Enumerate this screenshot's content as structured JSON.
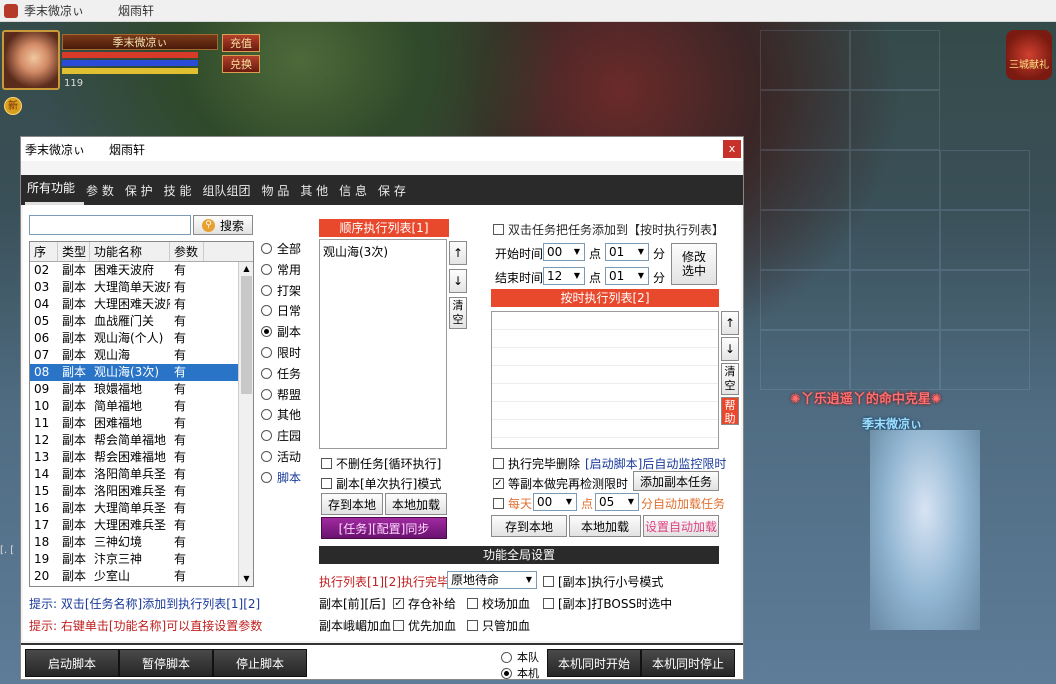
{
  "window": {
    "title_user": "季末微凉ぃ",
    "title_server": "烟雨轩"
  },
  "hud": {
    "player_name": "季末微凉ぃ",
    "level": "119",
    "recharge": "充值",
    "exchange": "兑换",
    "new_badge": "新",
    "gift_label": "三城献礼"
  },
  "scene": {
    "char_title": "✺丫乐逍遥丫的命中克星✺",
    "char_name": "季末微凉ぃ",
    "left_edge": "[. ["
  },
  "dialog": {
    "title_user": "季末微凉ぃ",
    "title_server": "烟雨轩",
    "close": "x",
    "tabs": [
      "所有功能",
      "参 数",
      "保 护",
      "技 能",
      "组队组团",
      "物 品",
      "其 他",
      "信 息",
      "保 存"
    ],
    "search": {
      "value": "",
      "button": "搜索"
    },
    "table": {
      "headers": [
        "序",
        "类型",
        "功能名称",
        "参数"
      ],
      "rows": [
        [
          "02",
          "副本",
          "困难天波府",
          "有"
        ],
        [
          "03",
          "副本",
          "大理简单天波府",
          "有"
        ],
        [
          "04",
          "副本",
          "大理困难天波府",
          "有"
        ],
        [
          "05",
          "副本",
          "血战雁门关",
          "有"
        ],
        [
          "06",
          "副本",
          "观山海(个人)",
          "有"
        ],
        [
          "07",
          "副本",
          "观山海",
          "有"
        ],
        [
          "08",
          "副本",
          "观山海(3次)",
          "有"
        ],
        [
          "09",
          "副本",
          "琅嬛福地",
          "有"
        ],
        [
          "10",
          "副本",
          "简单福地",
          "有"
        ],
        [
          "11",
          "副本",
          "困难福地",
          "有"
        ],
        [
          "12",
          "副本",
          "帮会简单福地",
          "有"
        ],
        [
          "13",
          "副本",
          "帮会困难福地",
          "有"
        ],
        [
          "14",
          "副本",
          "洛阳简单兵圣",
          "有"
        ],
        [
          "15",
          "副本",
          "洛阳困难兵圣",
          "有"
        ],
        [
          "16",
          "副本",
          "大理简单兵圣",
          "有"
        ],
        [
          "17",
          "副本",
          "大理困难兵圣",
          "有"
        ],
        [
          "18",
          "副本",
          "三神幻境",
          "有"
        ],
        [
          "19",
          "副本",
          "汴京三神",
          "有"
        ],
        [
          "20",
          "副本",
          "少室山",
          "有"
        ]
      ],
      "selected_row": 6
    },
    "categories": [
      "全部",
      "常用",
      "打架",
      "日常",
      "副本",
      "限时",
      "任务",
      "帮盟",
      "其他",
      "庄园",
      "活动",
      "脚本"
    ],
    "selected_category": 4,
    "hints": [
      "提示: 双击[任务名称]添加到执行列表[1][2]",
      "提示: 右键单击[功能名称]可以直接设置参数"
    ],
    "seq_list": {
      "header": "顺序执行列表[1]",
      "items": [
        "观山海(3次)"
      ],
      "up": "↑",
      "down": "↓",
      "clear": "清空"
    },
    "seq_opts": {
      "no_delete": "不删任务[循环执行]",
      "single_mode": "副本[单次执行]模式",
      "save": "存到本地",
      "load": "本地加载",
      "sync": "[任务][配置]同步"
    },
    "timed": {
      "dblclick": "双击任务把任务添加到【按时执行列表】",
      "start_label": "开始时间",
      "start_h": "00",
      "start_m": "01",
      "end_label": "结束时间",
      "end_h": "12",
      "end_m": "01",
      "hour_unit": "点",
      "min_unit": "分",
      "modify": "修改选中",
      "header": "按时执行列表[2]",
      "up": "↑",
      "down": "↓",
      "clear": "清空",
      "help": "帮助"
    },
    "timed_opts": {
      "done_delete": "执行完毕删除",
      "auto_monitor": "[启动脚本]后自动监控限时",
      "wait_dungeon": "等副本做完再检测限时",
      "add_dungeon": "添加副本任务",
      "daily": "每天",
      "daily_h": "00",
      "daily_unit": "点",
      "daily_m": "05",
      "auto_load": "分自动加载任务",
      "save": "存到本地",
      "load": "本地加载",
      "set_auto": "设置自动加载"
    },
    "global": {
      "header": "功能全局设置",
      "exec_done_label": "执行列表[1][2]执行完毕",
      "exec_done_value": "原地待命",
      "small_mode": "[副本]执行小号模式",
      "pre_post": "副本[前][后]",
      "restock": "存仓补给",
      "arena": "校场加血",
      "boss_select": "[副本]打BOSS时选中",
      "emei": "副本峨嵋加血",
      "priority": "优先加血",
      "only": "只管加血"
    },
    "footer": {
      "start": "启动脚本",
      "pause": "暂停脚本",
      "stop": "停止脚本",
      "team": "本队",
      "local": "本机",
      "sync_start": "本机同时开始",
      "sync_stop": "本机同时停止"
    }
  }
}
